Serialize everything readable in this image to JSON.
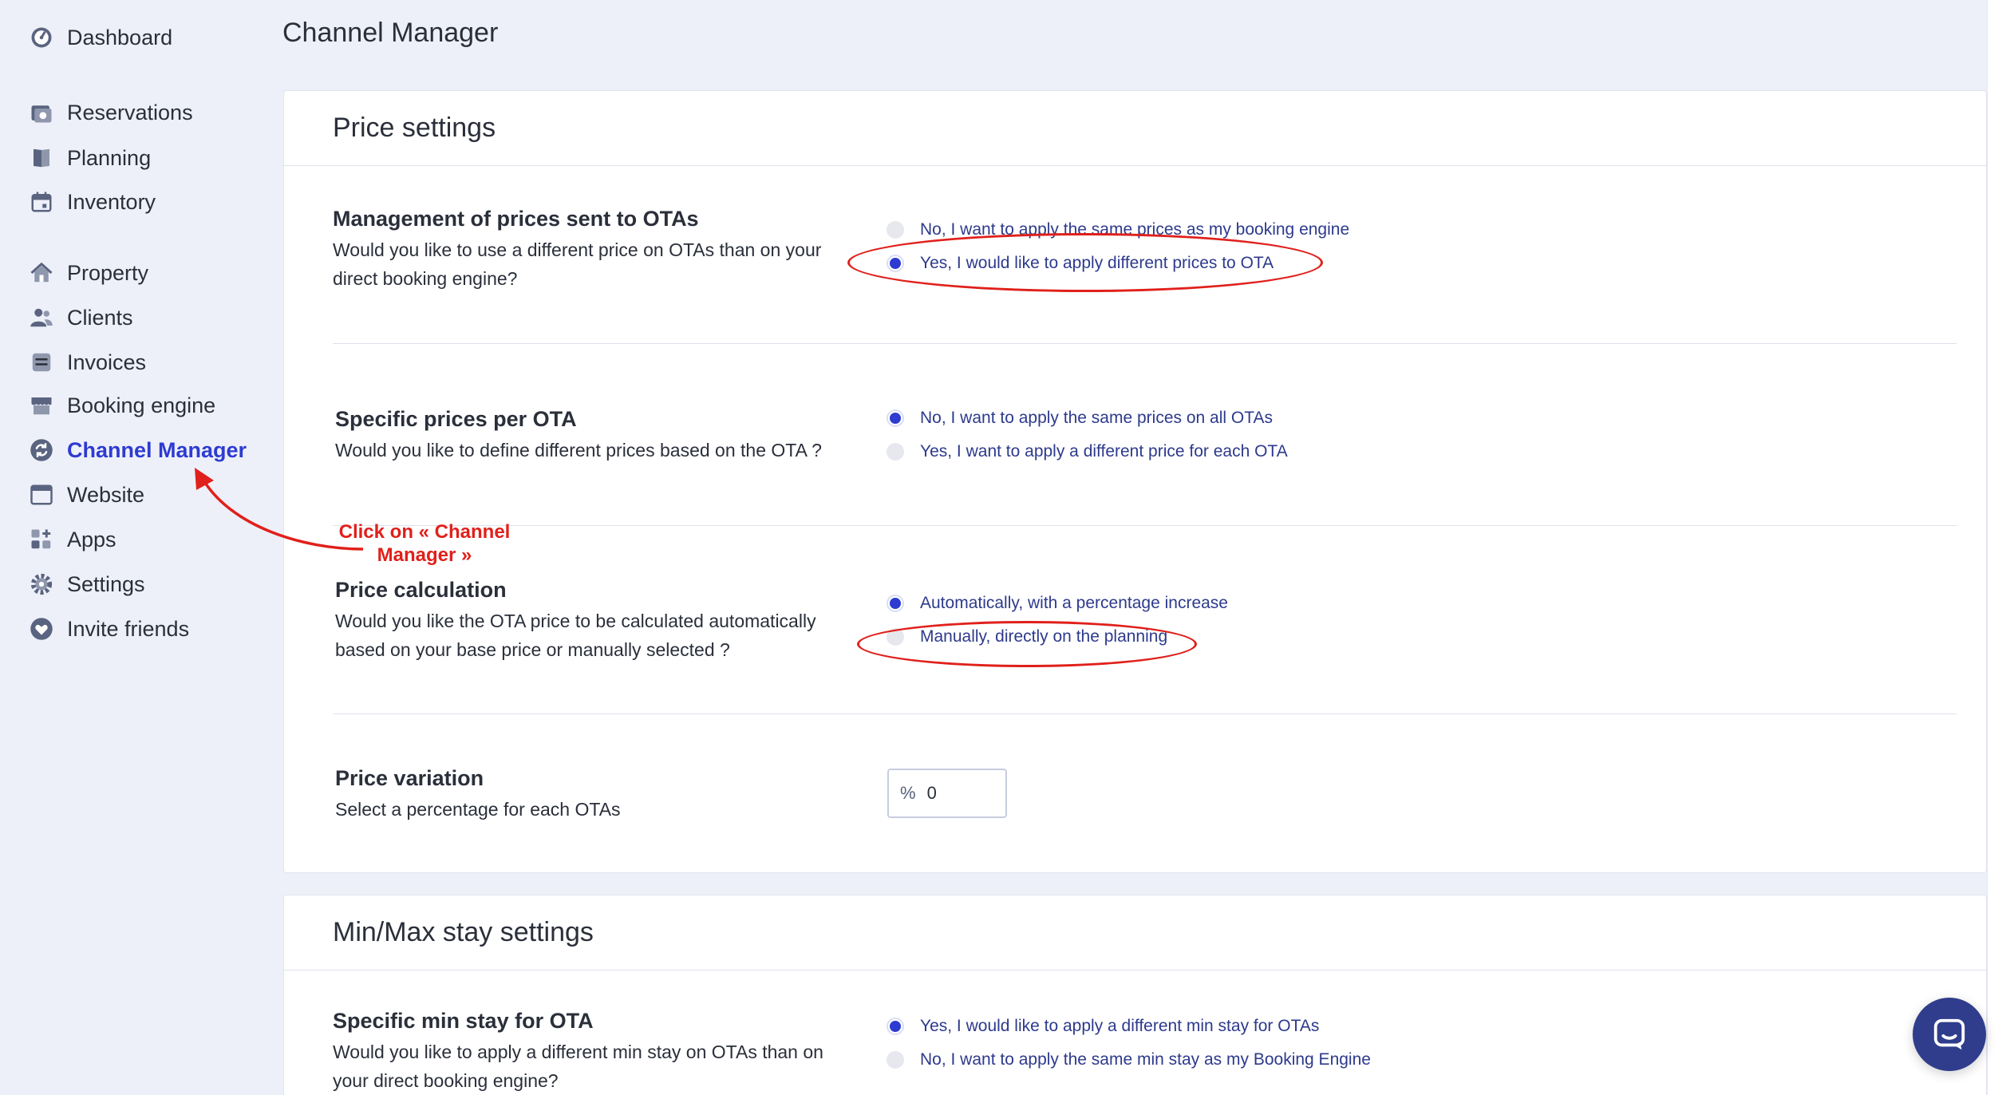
{
  "sidebar": {
    "items": [
      {
        "label": "Dashboard",
        "icon": "dashboard-icon"
      },
      {
        "label": "Reservations",
        "icon": "reservations-icon"
      },
      {
        "label": "Planning",
        "icon": "planning-icon"
      },
      {
        "label": "Inventory",
        "icon": "inventory-icon"
      },
      {
        "label": "Property",
        "icon": "home-icon"
      },
      {
        "label": "Clients",
        "icon": "clients-icon"
      },
      {
        "label": "Invoices",
        "icon": "invoices-icon"
      },
      {
        "label": "Booking engine",
        "icon": "store-icon"
      },
      {
        "label": "Channel Manager",
        "icon": "sync-icon",
        "active": true
      },
      {
        "label": "Website",
        "icon": "browser-window-icon"
      },
      {
        "label": "Apps",
        "icon": "apps-grid-icon"
      },
      {
        "label": "Settings",
        "icon": "gear-icon"
      },
      {
        "label": "Invite friends",
        "icon": "heart-icon"
      }
    ]
  },
  "header": {
    "title": "Channel Manager"
  },
  "price_settings": {
    "title": "Price settings",
    "management": {
      "title": "Management of prices sent to OTAs",
      "description": "Would you like to use a different price on OTAs than on your direct booking engine?",
      "options": [
        {
          "label": "No, I want to apply the same prices as my booking engine",
          "checked": false
        },
        {
          "label": "Yes, I would like to apply different prices to OTA",
          "checked": true
        }
      ]
    },
    "specific": {
      "title": "Specific prices per OTA",
      "description": "Would you like to define different prices based on the OTA ?",
      "options": [
        {
          "label": "No, I want to apply the same prices on all OTAs",
          "checked": true
        },
        {
          "label": "Yes, I want to apply a different price for each OTA",
          "checked": false
        }
      ]
    },
    "calculation": {
      "title": "Price calculation",
      "description": "Would you like the OTA price to be calculated automatically based on your base price or manually selected ?",
      "options": [
        {
          "label": "Automatically, with a percentage increase",
          "checked": true
        },
        {
          "label": "Manually, directly on the planning",
          "checked": false
        }
      ]
    },
    "variation": {
      "title": "Price variation",
      "description": "Select a percentage for each OTAs",
      "unit": "%",
      "value": "0"
    }
  },
  "minmax_settings": {
    "title": "Min/Max stay settings",
    "specific_min": {
      "title": "Specific min stay for OTA",
      "description": "Would you like to apply a different min stay on OTAs than on your direct booking engine?",
      "options": [
        {
          "label": "Yes, I would like to apply a different min stay for OTAs",
          "checked": true
        },
        {
          "label": "No, I want to apply the same min stay as my Booking Engine",
          "checked": false
        }
      ]
    }
  },
  "annotation": {
    "text": "Click on « Channel Manager »",
    "color": "#e0201b"
  },
  "colors": {
    "accent": "#2d3bd1",
    "background": "#eef0f9",
    "chat": "#2f3d8c"
  }
}
